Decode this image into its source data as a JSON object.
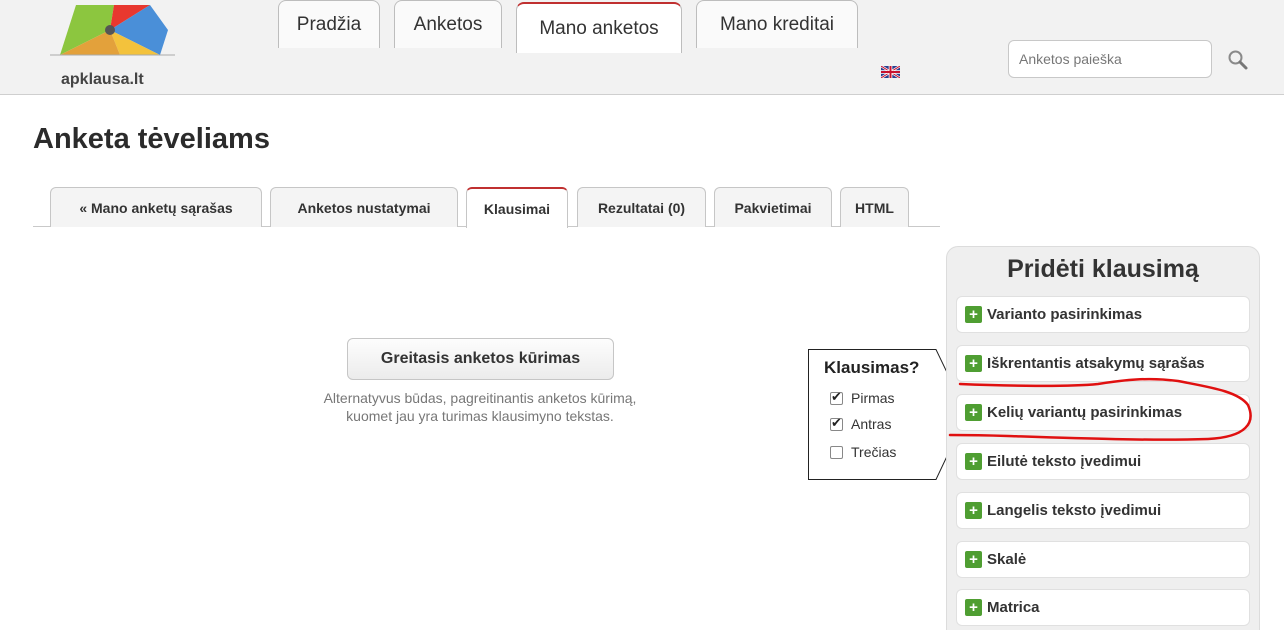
{
  "header": {
    "logo_text": "apklausa.lt",
    "tabs": [
      "Pradžia",
      "Anketos",
      "Mano anketos",
      "Mano kreditai"
    ],
    "active_tab": "Mano anketos",
    "search_placeholder": "Anketos paieška",
    "lang_icon": "uk-flag-icon",
    "search_icon": "magnifier-icon"
  },
  "page": {
    "title": "Anketa tėveliams",
    "subtabs": [
      "« Mano anketų sąrašas",
      "Anketos nustatymai",
      "Klausimai",
      "Rezultatai (0)",
      "Pakvietimai",
      "HTML"
    ],
    "active_subtab": "Klausimai"
  },
  "quick": {
    "button_label": "Greitasis anketos kūrimas",
    "description": "Alternatyvus būdas, pagreitinantis anketos kūrimą, kuomet jau yra turimas klausimyno tekstas."
  },
  "callout": {
    "title": "Klausimas?",
    "options": [
      {
        "label": "Pirmas",
        "checked": true
      },
      {
        "label": "Antras",
        "checked": true
      },
      {
        "label": "Trečias",
        "checked": false
      }
    ]
  },
  "panel": {
    "title": "Pridėti klausimą",
    "items": [
      "Varianto pasirinkimas",
      "Iškrentantis atsakymų sąrašas",
      "Kelių variantų pasirinkimas",
      "Eilutė teksto įvedimui",
      "Langelis teksto įvedimui",
      "Skalė",
      "Matrica"
    ],
    "highlighted_item": "Kelių variantų pasirinkimas"
  },
  "colors": {
    "accent_red": "#c03030",
    "plus_green": "#4f9e32",
    "annotation_red": "#e01010"
  }
}
